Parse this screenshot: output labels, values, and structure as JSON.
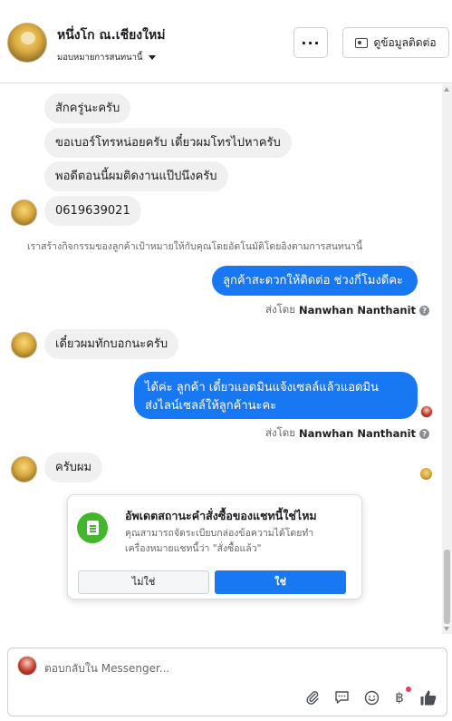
{
  "header": {
    "contact_name": "หนึ่งโก ณ.เชียงใหม่",
    "assign_label": "มอบหมายการสนทนานี้",
    "more_label": "···",
    "view_contact_label": "ดูข้อมูลติดต่อ"
  },
  "messages": {
    "in_1": "สักครู่นะครับ",
    "in_2": "ขอเบอร์โทรหน่อยครับ เดี๋ยวผมโทรไปหาครับ",
    "in_3": "พอดีตอนนี้ผมติดงานแป๊ปนึงครับ",
    "in_4": "0619639021",
    "system_note": "เราสร้างกิจกรรมของลูกค้าเป้าหมายให้กับคุณโดยอัตโนมัติโดยอิงตามการสนทนานี้",
    "out_1": "ลูกค้าสะดวกให้ติดต่อ ช่วงกี่โมงดีคะ",
    "sent_by_1_prefix": "ส่งโดย",
    "sent_by_1_name": "Nanwhan Nanthanit",
    "in_5": "เดี๋ยวผมทักบอกนะครับ",
    "out_2_line1": "ได้ค่ะ ลูกค้า เดี๋ยวแอดมินแจ้งเซลล์แล้วแอดมิน",
    "out_2_line2": "ส่งไลน์เซลล์ให้ลูกค้านะคะ",
    "sent_by_2_prefix": "ส่งโดย",
    "sent_by_2_name": "Nanwhan Nanthanit",
    "in_6": "ครับผม"
  },
  "order_card": {
    "title": "อัพเดตสถานะคำสั่งซื้อของแชทนี้ใช่ไหม",
    "body": "คุณสามารถจัดระเบียบกล่องข้อความได้โดยทำเครื่องหมายแชทนี้ว่า \"สั่งซื้อแล้ว\"",
    "no_label": "ไม่ใช่",
    "yes_label": "ใช่"
  },
  "composer": {
    "placeholder": "ตอบกลับใน Messenger...",
    "baht_symbol": "฿"
  },
  "colors": {
    "accent": "#1877f2",
    "incoming_bubble": "#f0f0f0",
    "order_icon": "#42b72a"
  }
}
